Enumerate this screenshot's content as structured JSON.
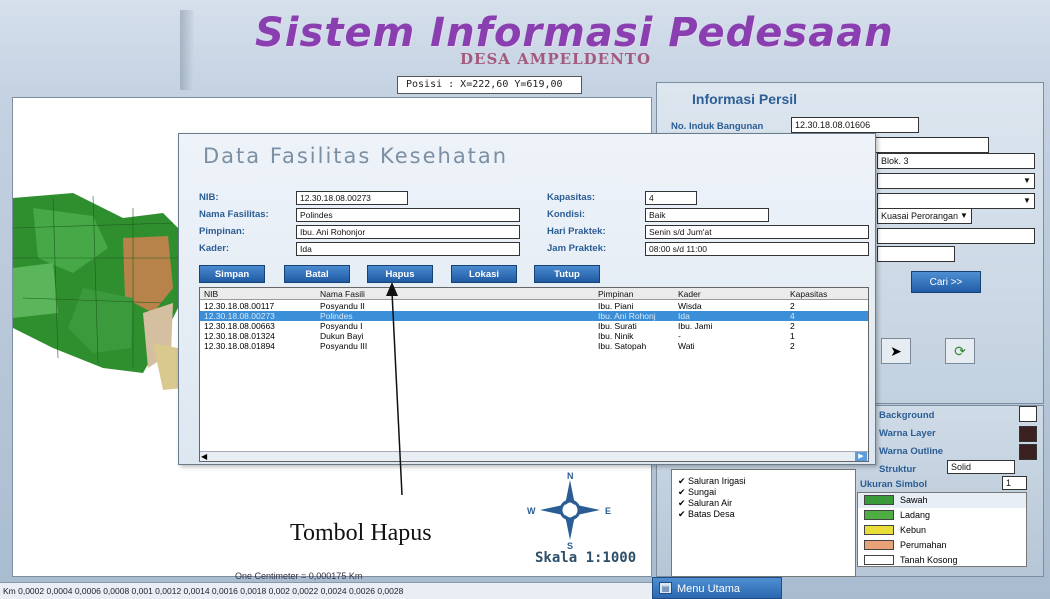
{
  "app": {
    "title": "Sistem Informasi Pedesaan",
    "subtitle": "DESA AMPELDENTO",
    "posisi": "Posisi : X=222,60 Y=619,00"
  },
  "dialog": {
    "title": "Data Fasilitas Kesehatan",
    "labels": {
      "nib": "NIB:",
      "nama_fasilitas": "Nama Fasilitas:",
      "pimpinan": "Pimpinan:",
      "kader": "Kader:",
      "kapasitas": "Kapasitas:",
      "kondisi": "Kondisi:",
      "hari_praktek": "Hari Praktek:",
      "jam_praktek": "Jam Praktek:"
    },
    "values": {
      "nib": "12.30.18.08.00273",
      "nama_fasilitas": "Polindes",
      "pimpinan": "Ibu. Ani Rohonjor",
      "kader": "Ida",
      "kapasitas": "4",
      "kondisi": "Baik",
      "hari_praktek": "Senin s/d Jum'at",
      "jam_praktek": "08:00 s/d 11:00"
    },
    "buttons": {
      "simpan": "Simpan",
      "batal": "Batal",
      "hapus": "Hapus",
      "lokasi": "Lokasi",
      "tutup": "Tutup"
    },
    "grid": {
      "headers": [
        "NIB",
        "Nama Fasili",
        "Pimpinan",
        "Kader",
        "Kapasitas"
      ],
      "rows": [
        [
          "12.30.18.08.00117",
          "Posyandu II",
          "Ibu. Piani",
          "Wisda",
          "2"
        ],
        [
          "12.30.18.08.00273",
          "Polindes",
          "Ibu. Ani Rohonj",
          "Ida",
          "4"
        ],
        [
          "12.30.18.08.00663",
          "Posyandu I",
          "Ibu. Surati",
          "Ibu. Jami",
          "2"
        ],
        [
          "12.30.18.08.01324",
          "Dukun Bayi",
          "Ibu. Ninik",
          "-",
          "1"
        ],
        [
          "12.30.18.08.01894",
          "Posyandu III",
          "Ibu. Satopah",
          "Wati",
          "2"
        ]
      ],
      "selected_row": 1
    }
  },
  "annotation": {
    "tombol_hapus": "Tombol Hapus"
  },
  "map": {
    "skala": "Skala 1:1000",
    "compass": {
      "n": "N",
      "s": "S",
      "w": "W",
      "e": "E"
    },
    "scale_caption": "One Centimeter = 0,000175 Km",
    "scale_ticks": "Km  0,0002  0,0004  0,0006  0,0008  0,001   0,0012  0,0014  0,0016  0,0018   0,002   0,0022  0,0024  0,0026 0,0028"
  },
  "info": {
    "title": "Informasi Persil",
    "no_induk_label": "No. Induk Bangunan",
    "no_induk_value": "12.30.18.08.01606",
    "blok_value": "Blok. 3",
    "status_value": "Kuasai Perorangan",
    "cari_label": "Cari >>"
  },
  "layers": {
    "background_label": "Background",
    "warna_layer_label": "Warna Layer",
    "warna_outline_label": "Warna Outline",
    "struktur_label": "Struktur",
    "struktur_value": "Solid",
    "ukuran_simbol_label": "Ukuran Simbol",
    "ukuran_value": "1",
    "items": [
      "Saluran Irigasi",
      "Sungai",
      "Saluran Air",
      "Batas Desa"
    ],
    "symbols": [
      {
        "name": "Sawah",
        "color": "#3a9a3a"
      },
      {
        "name": "Ladang",
        "color": "#4fae43"
      },
      {
        "name": "Kebun",
        "color": "#e8dd3a"
      },
      {
        "name": "Perumahan",
        "color": "#e9a17a"
      },
      {
        "name": "Tanah Kosong",
        "color": "#ffffff"
      }
    ]
  },
  "menu_utama": "Menu Utama"
}
